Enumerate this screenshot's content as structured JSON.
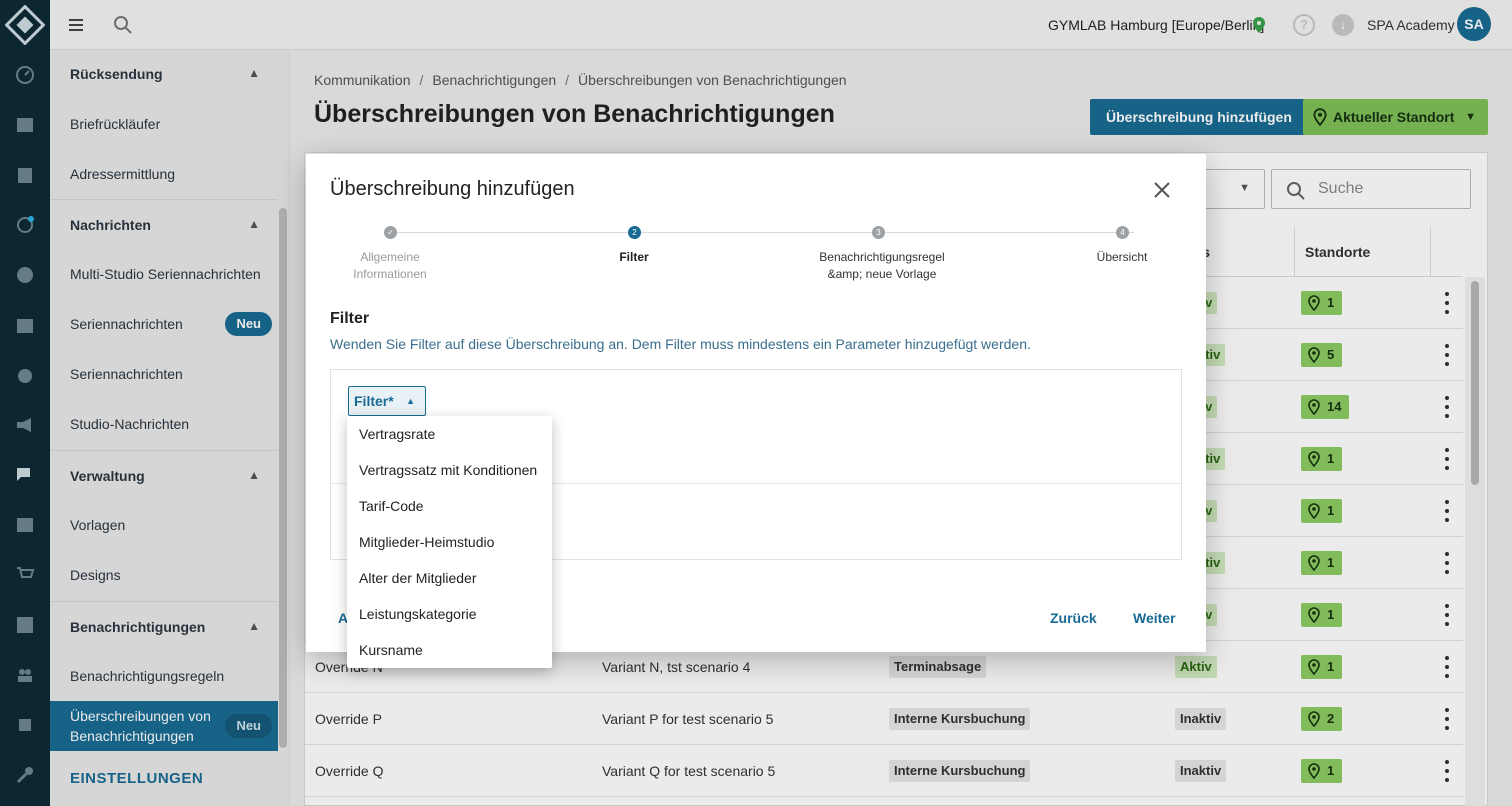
{
  "topbar": {
    "location": "GYMLAB Hamburg [Europe/Berlin]",
    "help": "?",
    "account_name": "SPA Academy",
    "avatar_initials": "SA"
  },
  "sidebar": {
    "sections": [
      {
        "title": "Rücksendung",
        "items": [
          "Briefrückläufer",
          "Adressermittlung"
        ]
      },
      {
        "title": "Nachrichten",
        "items": [
          "Multi-Studio Seriennachrichten",
          "Seriennachrichten",
          "Seriennachrichten",
          "Studio-Nachrichten"
        ]
      },
      {
        "title": "Verwaltung",
        "items": [
          "Vorlagen",
          "Designs"
        ]
      },
      {
        "title": "Benachrichtigungen",
        "items": [
          "Benachrichtigungsregeln",
          "Überschreibungen von Benachrichtigungen"
        ]
      }
    ],
    "badge_new": "Neu",
    "settings": "EINSTELLUNGEN"
  },
  "main": {
    "breadcrumbs": [
      "Kommunikation",
      "Benachrichtigungen",
      "Überschreibungen von Benachrichtigungen"
    ],
    "breadcrumb_sep": "/",
    "title": "Überschreibungen von Benachrichtigungen",
    "add_button": "Überschreibung hinzufügen",
    "location_button": "Aktueller Standort",
    "search_placeholder": "Suche",
    "columns": {
      "status": "tus",
      "locations": "Standorte"
    },
    "rows": [
      {
        "status": "ktiv",
        "locations": "1"
      },
      {
        "status": "nktiv",
        "locations": "5"
      },
      {
        "status": "ktiv",
        "locations": "14"
      },
      {
        "status": "nktiv",
        "locations": "1"
      },
      {
        "status": "ktiv",
        "locations": "1"
      },
      {
        "status": "nktiv",
        "locations": "1"
      },
      {
        "status": "ktiv",
        "locations": "1"
      },
      {
        "name": "Override N",
        "description": "Variant N, tst scenario 4",
        "type": "Terminabsage",
        "status": "Aktiv",
        "locations": "1"
      },
      {
        "name": "Override P",
        "description": "Variant P for test scenario 5",
        "type": "Interne Kursbuchung",
        "status": "Inaktiv",
        "locations": "2"
      },
      {
        "name": "Override Q",
        "description": "Variant Q for test scenario 5",
        "type": "Interne Kursbuchung",
        "status": "Inaktiv",
        "locations": "1"
      }
    ]
  },
  "modal": {
    "title": "Überschreibung hinzufügen",
    "steps": [
      {
        "number": "✓",
        "label_line1": "Allgemeine",
        "label_line2": "Informationen"
      },
      {
        "number": "2",
        "label_line1": "Filter",
        "label_line2": ""
      },
      {
        "number": "3",
        "label_line1": "Benachrichtigungsregel",
        "label_line2": "&amp; neue Vorlage"
      },
      {
        "number": "4",
        "label_line1": "Übersicht",
        "label_line2": ""
      }
    ],
    "section_title": "Filter",
    "section_desc": "Wenden Sie Filter auf diese Überschreibung an. Dem Filter muss mindestens ein Parameter hinzugefügt werden.",
    "filter_button": "Filter*",
    "partial_left_button": "A",
    "back_button": "Zurück",
    "next_button": "Weiter"
  },
  "dropdown": {
    "options": [
      "Vertragsrate",
      "Vertragssatz mit Konditionen",
      "Tarif-Code",
      "Mitglieder-Heimstudio",
      "Alter der Mitglieder",
      "Leistungskategorie",
      "Kursname"
    ]
  },
  "colors": {
    "primary": "#1a6b93",
    "rail": "#0e2b36",
    "location_green": "#8ccb63",
    "active_status_bg": "#d4ecc4"
  },
  "icons": [
    "logo-icon",
    "menu-icon",
    "search-icon",
    "pin-icon",
    "help-icon",
    "download-icon",
    "close-icon",
    "check-icon",
    "caret-up-icon",
    "kebab-icon"
  ]
}
